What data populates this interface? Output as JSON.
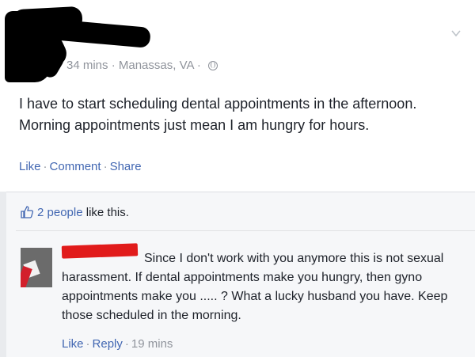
{
  "post": {
    "timestamp": "34 mins",
    "location": "Manassas, VA",
    "privacy_icon": "globe-icon",
    "text": "I have to start scheduling dental appointments in the afternoon. Morning appointments just mean I am hungry for hours.",
    "actions": {
      "like": "Like",
      "comment": "Comment",
      "share": "Share"
    },
    "menu_icon": "chevron-down-icon"
  },
  "likes": {
    "icon": "thumbs-up-icon",
    "count_text": "2 people",
    "rest_text": "like this."
  },
  "comment": {
    "text": "Since I don't work with you anymore this is not sexual harassment. If dental appointments make you hungry, then gyno appointments make you ..... ? What a lucky husband you have. Keep those scheduled in the morning.",
    "actions": {
      "like": "Like",
      "reply": "Reply"
    },
    "time": "19 mins"
  },
  "colors": {
    "link": "#4267b2",
    "meta": "#90949c",
    "redaction_post": "#000000",
    "redaction_comment": "#e11b1b"
  }
}
